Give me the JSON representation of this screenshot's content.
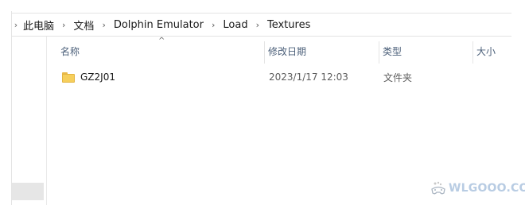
{
  "breadcrumb": {
    "items": [
      "此电脑",
      "文档",
      "Dolphin Emulator",
      "Load",
      "Textures"
    ],
    "separator": "›"
  },
  "columns": {
    "name": "名称",
    "date_modified": "修改日期",
    "type": "类型",
    "size": "大小",
    "sort_indicator": "^"
  },
  "files": [
    {
      "name": "GZ2J01",
      "date_modified": "2023/1/17 12:03",
      "type": "文件夹",
      "icon": "folder-icon"
    }
  ],
  "watermark": {
    "text": "WLGOOO.COM",
    "icon": "gamepad-icon"
  },
  "colors": {
    "header_text": "#4c607a",
    "folder": "#f6cf5c",
    "watermark": "#b8cce3"
  }
}
